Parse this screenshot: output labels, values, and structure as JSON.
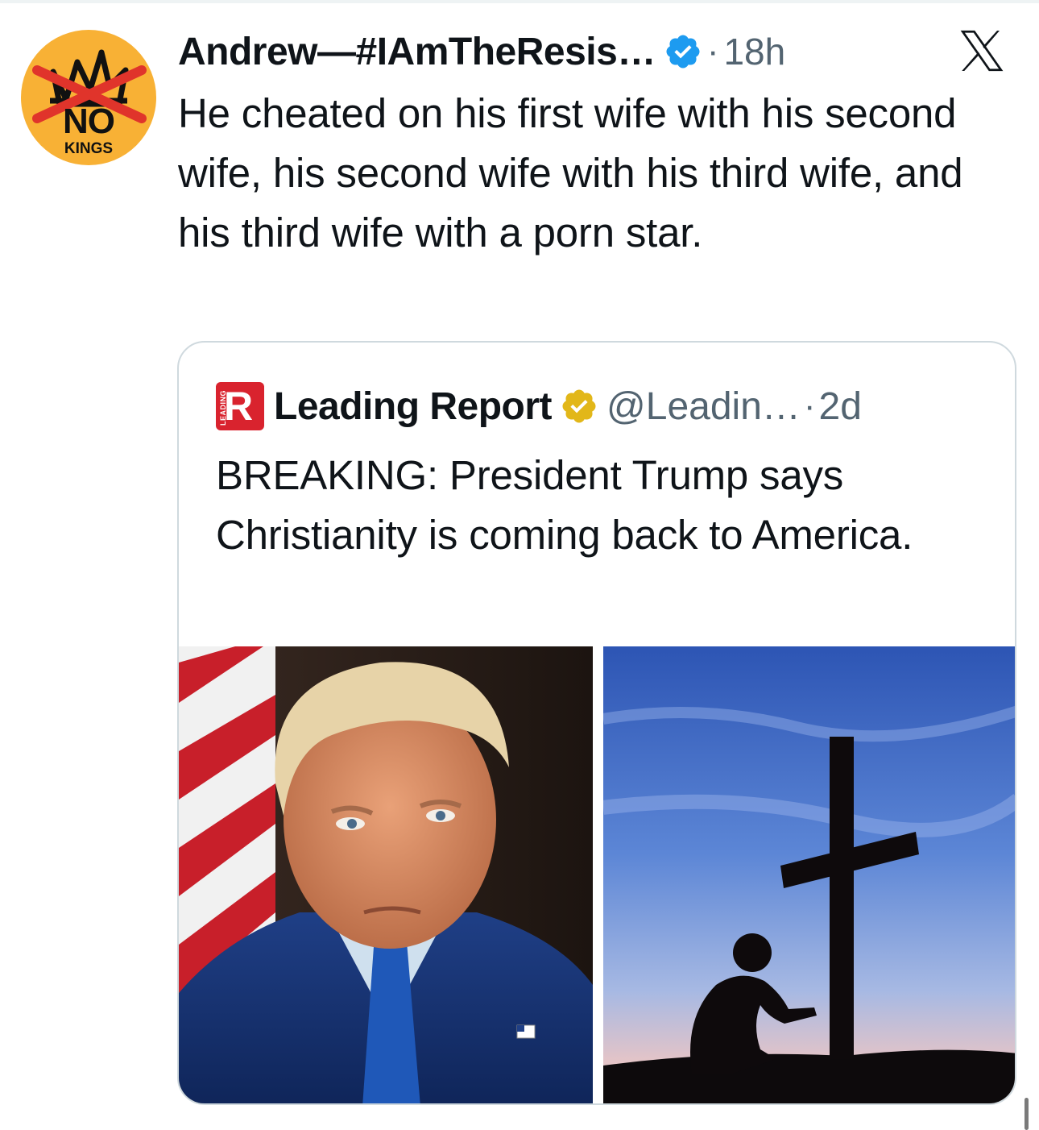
{
  "tweet": {
    "author": {
      "name": "Andrew—#IAmTheResis…",
      "avatar_text_top": "NO",
      "avatar_text_bottom": "KINGS",
      "avatar_color": "#f8b135",
      "verified_icon": "verified-badge-blue"
    },
    "separator": "·",
    "time": "18h",
    "text": "He cheated on his first wife with his second wife, his second wife with his third wife, and his third wife with a porn star."
  },
  "quoted_tweet": {
    "logo_letter": "R",
    "logo_side_text": "LEADING",
    "author_name": "Leading Report",
    "verified_icon": "verified-badge-gold",
    "handle": "@Leadin…",
    "separator": "·",
    "time": "2d",
    "text": "BREAKING: President Trump says Christianity is coming back to America.",
    "images": [
      {
        "icon": "portrait-photo"
      },
      {
        "icon": "cross-silhouette-photo"
      }
    ]
  },
  "app_logo": "x-logo-icon",
  "colors": {
    "text": "#0f1419",
    "secondary": "#536471",
    "verified_blue": "#1d9bf0",
    "verified_gold": "#e2b719",
    "brand_red": "#d9232e",
    "border": "#cfd9de"
  }
}
